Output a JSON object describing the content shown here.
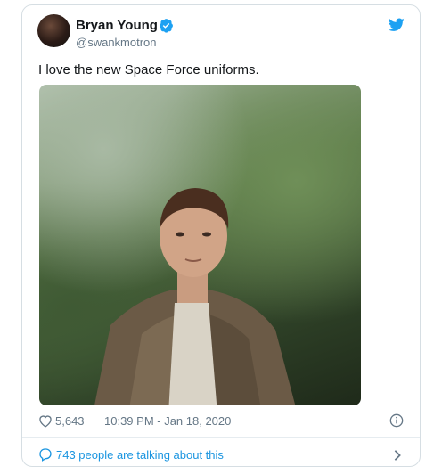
{
  "author": {
    "name": "Bryan Young",
    "handle": "@swankmotron",
    "avatar_icon": "user-avatar",
    "verified_icon": "verified-badge-icon"
  },
  "brand": {
    "icon": "twitter-bird-icon",
    "color": "#1da1f2"
  },
  "tweet": {
    "text": "I love the new Space Force uniforms.",
    "media": "photo",
    "likes": "5,643",
    "timestamp": "10:39 PM - Jan 18, 2020"
  },
  "footer": {
    "talking_text": "743 people are talking about this"
  }
}
